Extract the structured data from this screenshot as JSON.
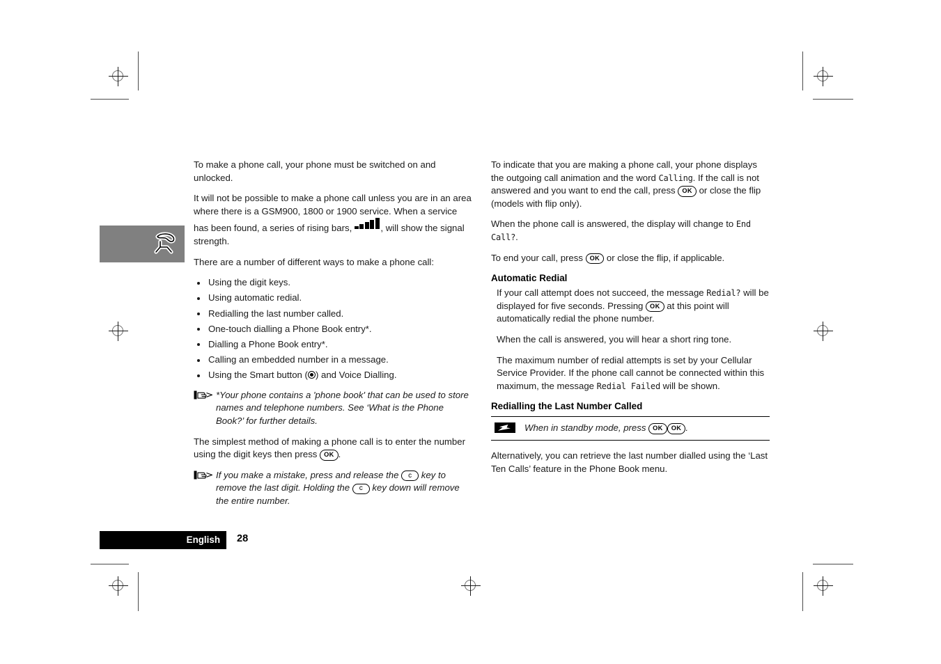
{
  "page": {
    "number": "28",
    "language_tab": "English",
    "chapter_icon": "phone-handset-icon"
  },
  "left_column": {
    "para_intro": "To make a phone call, your phone must be switched on and unlocked.",
    "para_coverage_1": "It will not be possible to make a phone call unless you are in an area where there is a GSM900, 1800 or 1900 service. When a service has been found, a series of rising bars, ",
    "para_coverage_2": ", will show the signal strength.",
    "para_ways": "There are a number of different ways to make a phone call:",
    "bullets": [
      "Using the digit keys.",
      "Using automatic redial.",
      "Redialling the last number called.",
      "One-touch dialling a Phone Book entry*.",
      "Dialling a Phone Book entry*.",
      "Calling an embedded number in a message.",
      "Using the Smart button (",
      ") and Voice Dialling."
    ],
    "note_phonebook": "*Your phone contains a 'phone book' that can be used to store names and telephone numbers. See ‘What is the Phone Book?’ for further details.",
    "para_simplest_1": "The simplest method of making a phone call is to enter the number using the digit keys then press ",
    "para_simplest_2": ".",
    "note_mistake_1": "If you make a mistake, press and release the ",
    "note_mistake_2": " key to remove the last digit. Holding the ",
    "note_mistake_3": " key down will remove the entire number.",
    "key_ok": "OK",
    "key_c": "c",
    "smart_button_icon": "smart-button-icon",
    "signal_bars": [
      4,
      7,
      10,
      13,
      16
    ]
  },
  "right_column": {
    "para_indicate_1": "To indicate that you are making a phone call, your phone displays the outgoing call animation and the word ",
    "para_indicate_lcd": "Calling",
    "para_indicate_2": ". If the call is not answered and you want to end the call, press ",
    "para_indicate_3": " or close the flip (models with flip only).",
    "para_answered_1": "When the phone call is answered, the display will change to ",
    "para_answered_lcd": "End Call?",
    "para_answered_2": ".",
    "para_endcall_1": "To end your call, press ",
    "para_endcall_2": " or close the flip, if applicable.",
    "heading_auto_redial": "Automatic Redial",
    "para_redial_1": "If your call attempt does not succeed, the message ",
    "para_redial_lcd": "Redial?",
    "para_redial_2": " will be displayed for five seconds. Pressing ",
    "para_redial_3": " at this point will automatically redial the phone number.",
    "para_ringtone": "When the call is answered, you will hear a short ring tone.",
    "para_max_1": "The maximum number of redial attempts is set by your Cellular Service Provider. If the phone call cannot be connected within this maximum, the message ",
    "para_max_lcd": "Redial Failed",
    "para_max_2": " will be shown.",
    "heading_redial_last": "Redialling the Last Number Called",
    "tip_1": "When in standby mode, press ",
    "tip_2": ".",
    "para_alternatively": "Alternatively, you can retrieve the last number dialled using the ‘Last Ten Calls’ feature in the Phone Book menu.",
    "key_ok": "OK",
    "bolt_icon": "lightning-bolt-icon"
  }
}
